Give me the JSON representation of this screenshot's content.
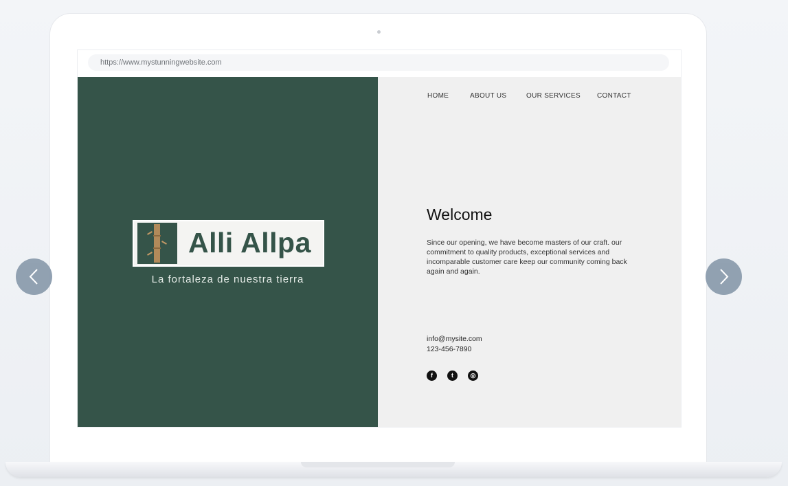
{
  "browser": {
    "url": "https://www.mystunningwebsite.com"
  },
  "brand": {
    "logo_text": "Alli Allpa",
    "tagline": "La fortaleza de nuestra tierra",
    "colors": {
      "primary_green": "#355449",
      "panel_gray": "#f0f0f0",
      "bamboo": "#b28a5a"
    }
  },
  "nav": {
    "items": [
      {
        "label": "HOME"
      },
      {
        "label": "ABOUT US"
      },
      {
        "label": "OUR SERVICES"
      },
      {
        "label": "CONTACT"
      }
    ]
  },
  "content": {
    "heading": "Welcome",
    "body": "Since our opening, we have become masters of our craft. our commitment to quality products, exceptional services and incomparable customer care keep our community coming back again and again."
  },
  "contact": {
    "email": "info@mysite.com",
    "phone": "123-456-7890"
  },
  "social": [
    {
      "icon": "facebook-icon",
      "glyph": "f"
    },
    {
      "icon": "twitter-icon",
      "glyph": "t"
    },
    {
      "icon": "instagram-icon",
      "glyph": "◎"
    }
  ],
  "carousel": {
    "prev_icon": "chevron-left-icon",
    "next_icon": "chevron-right-icon"
  }
}
